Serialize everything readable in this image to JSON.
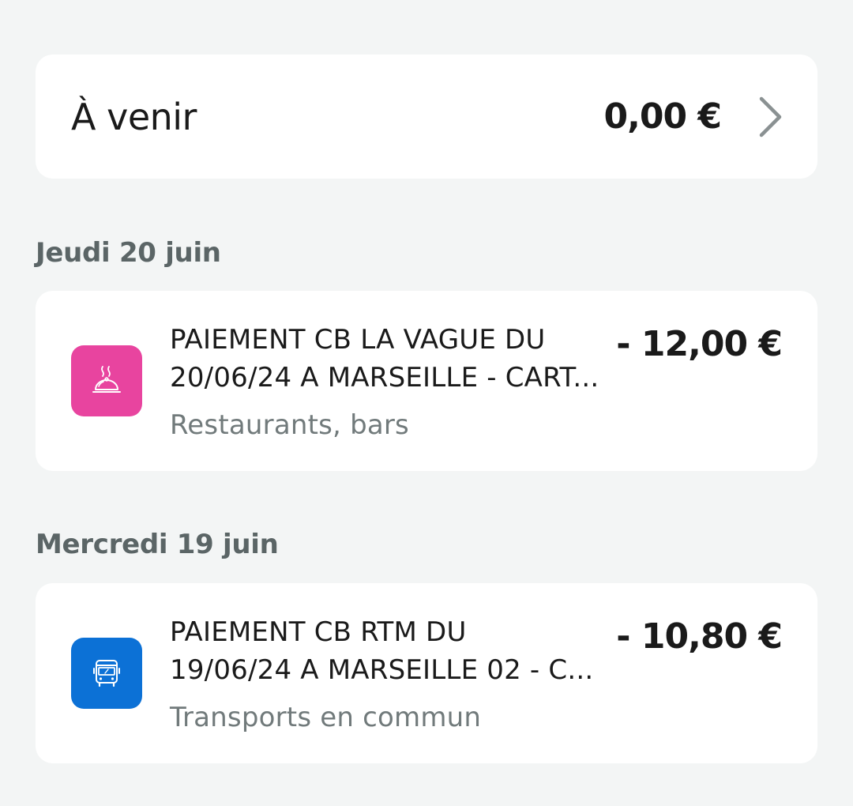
{
  "upcoming": {
    "label": "À venir",
    "amount": "0,00 €",
    "chevron_icon": "chevron-right-icon"
  },
  "groups": [
    {
      "date": "Jeudi 20 juin",
      "transactions": [
        {
          "title_line1": "PAIEMENT CB LA VAGUE DU",
          "title_line2": "20/06/24 A MARSEILLE - CART...",
          "category": "Restaurants, bars",
          "amount": "- 12,00 €",
          "icon": "restaurant-cloche-icon",
          "icon_color": "#e8449f"
        }
      ]
    },
    {
      "date": "Mercredi 19 juin",
      "transactions": [
        {
          "title_line1": "PAIEMENT CB RTM DU",
          "title_line2": "19/06/24 A MARSEILLE  02 - C...",
          "category": "Transports en commun",
          "amount": "- 10,80 €",
          "icon": "bus-icon",
          "icon_color": "#0c71d6"
        }
      ]
    }
  ],
  "colors": {
    "background": "#f3f5f5",
    "card": "#ffffff",
    "heading_gray": "#5b6566",
    "category_gray": "#717a7b"
  }
}
